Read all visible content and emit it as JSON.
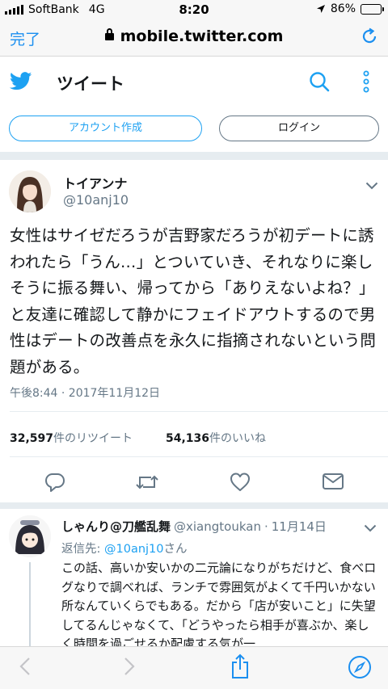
{
  "status_bar": {
    "carrier": "SoftBank",
    "network": "4G",
    "time": "8:20",
    "battery": "86%",
    "battery_fraction": 0.86
  },
  "browser": {
    "done_label": "完了",
    "url": "mobile.twitter.com"
  },
  "header": {
    "title": "ツイート"
  },
  "auth": {
    "signup_label": "アカウント作成",
    "login_label": "ログイン"
  },
  "tweet": {
    "name": "トイアンナ",
    "handle": "@10anj10",
    "text": "女性はサイゼだろうが吉野家だろうが初デートに誘われたら「うん…」とついていき、それなりに楽しそうに振る舞い、帰ってから「ありえないよね？」と友達に確認して静かにフェイドアウトするので男性はデートの改善点を永久に指摘されないという問題がある。",
    "timestamp": "午後8:44 · 2017年11月12日",
    "retweet_count": "32,597",
    "retweet_label": "件のリツイート",
    "like_count": "54,136",
    "like_label": "件のいいね"
  },
  "reply": {
    "name": "しゃんり@刀艦乱舞",
    "handle": "@xiangtoukan",
    "dot": "·",
    "date": "11月14日",
    "reply_to_prefix": "返信先: ",
    "reply_to_handle": "@10anj10",
    "reply_to_suffix": "さん",
    "text": "この話、高いか安いかの二元論になりがちだけど、食べログなりで調べれば、ランチで雰囲気がよくて千円いかない所なんていくらでもある。だから「店が安いこと」に失望してるんじゃなくて、「どうやったら相手が喜ぶか、楽しく時間を過ごせるか配慮する気が一"
  },
  "colors": {
    "twitter_blue": "#1da1f2",
    "safari_blue": "#1b8ff0",
    "gray_text": "#657786",
    "divider": "#e6ecf0"
  },
  "icons": [
    "twitter-bird-icon",
    "search-icon",
    "more-vertical-icon",
    "chevron-down-icon",
    "reply-icon",
    "retweet-icon",
    "like-icon",
    "dm-icon",
    "back-icon",
    "forward-icon",
    "share-icon",
    "compass-icon",
    "reload-icon",
    "lock-icon"
  ]
}
